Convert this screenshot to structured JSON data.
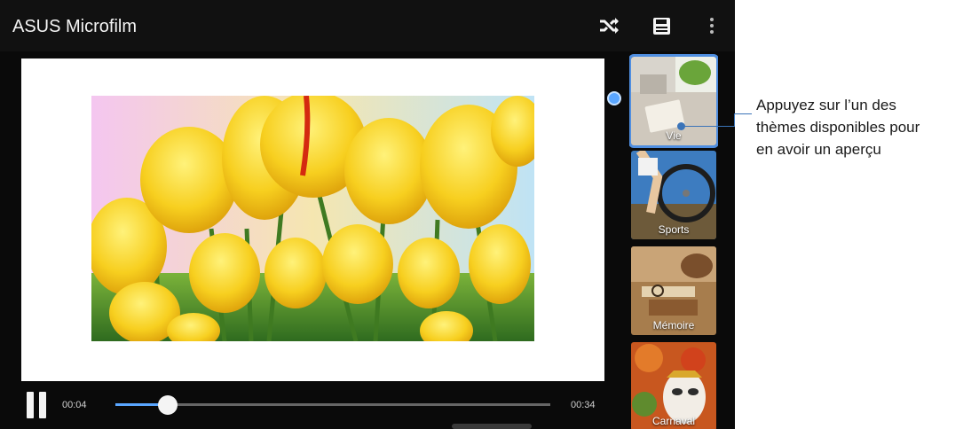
{
  "app": {
    "title": "ASUS Microfilm"
  },
  "toolbar": {
    "icons": [
      "shuffle-icon",
      "save-icon",
      "more-vert-icon"
    ]
  },
  "themes": [
    {
      "label": "Vie",
      "selected": true
    },
    {
      "label": "Sports",
      "selected": false
    },
    {
      "label": "Mémoire",
      "selected": false
    },
    {
      "label": "Carnaval",
      "selected": false
    }
  ],
  "player": {
    "current_time": "00:04",
    "total_time": "00:34",
    "progress_fraction": 0.12,
    "state": "playing"
  },
  "callout": {
    "lines": [
      "Appuyez sur l’un des",
      "thèmes disponibles pour",
      "en avoir un aperçu"
    ]
  },
  "colors": {
    "accent": "#5aa6ff",
    "callout_line": "#3b74b8",
    "background": "#0a0a0a"
  }
}
